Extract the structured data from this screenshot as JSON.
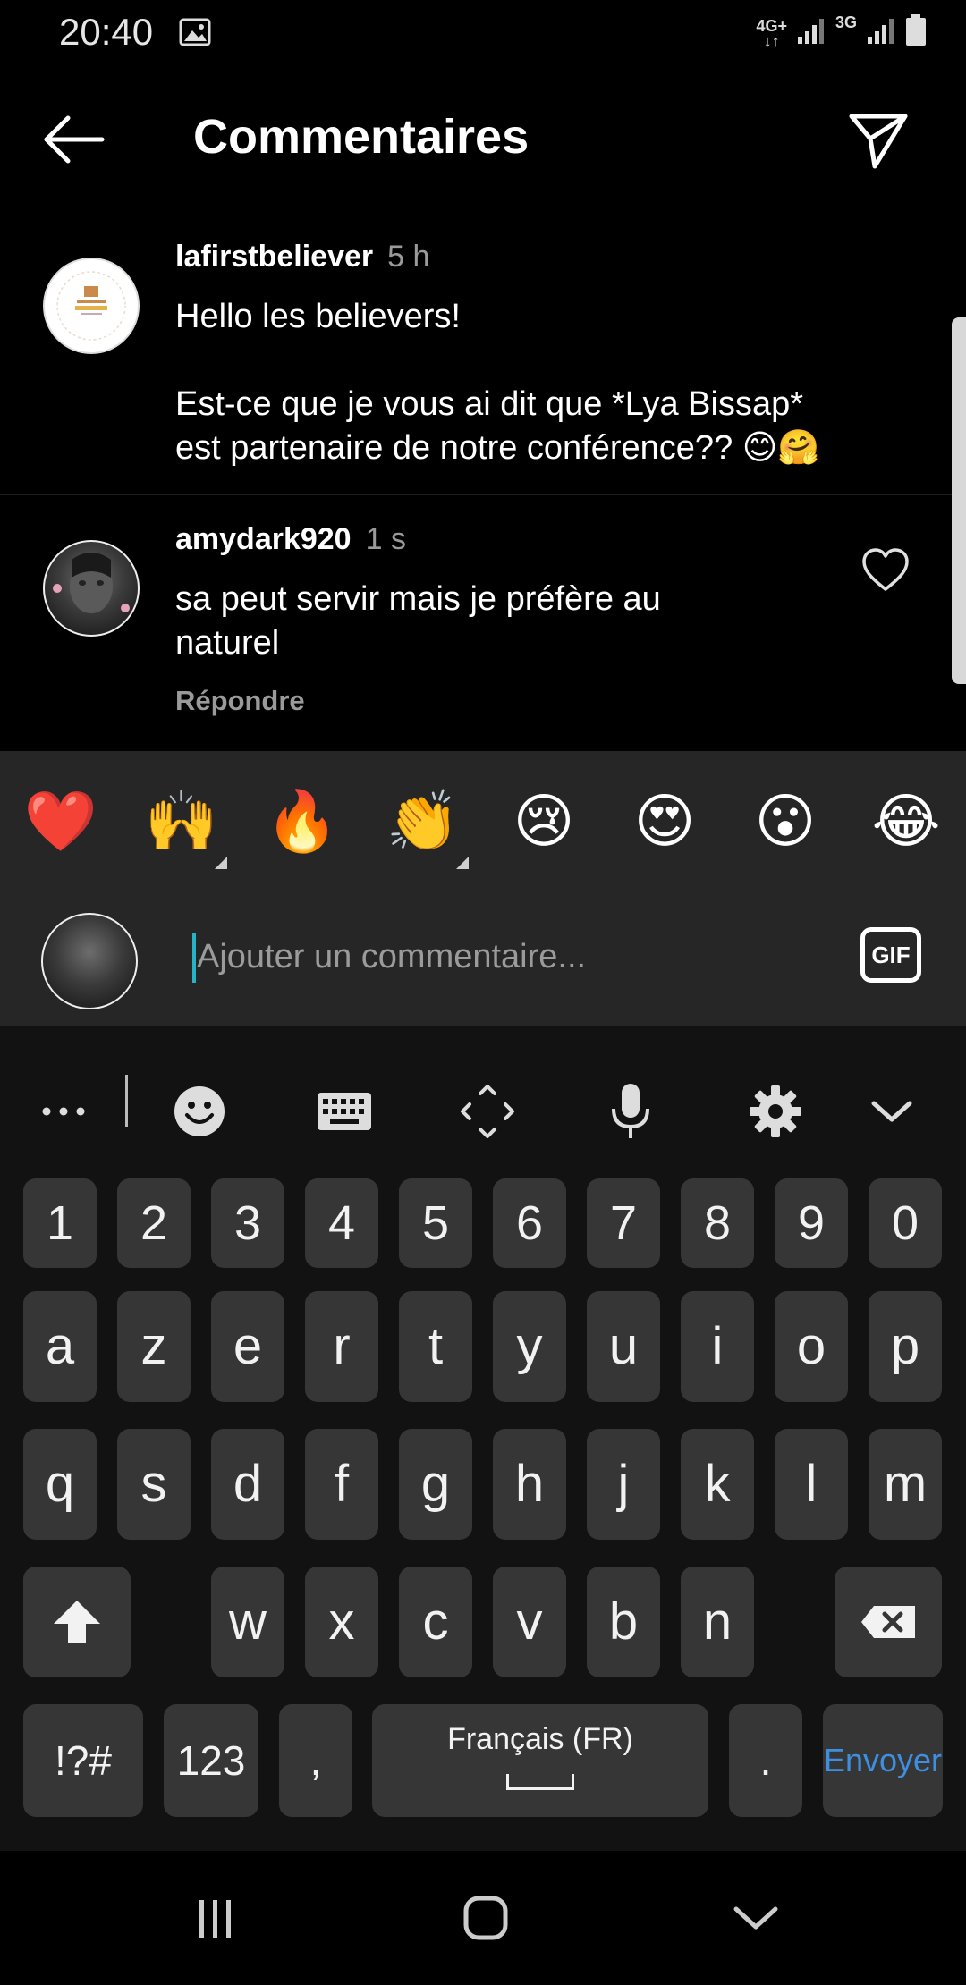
{
  "status_bar": {
    "time": "20:40",
    "net1": "4G+",
    "net2": "3G"
  },
  "header": {
    "title": "Commentaires",
    "back_icon": "arrow-left-icon",
    "send_icon": "paper-plane-icon"
  },
  "comments": [
    {
      "username": "lafirstbeliever",
      "time": "5 h",
      "line1": "Hello les believers!",
      "line2": "Est-ce que je vous ai dit que *Lya Bissap*",
      "line3": "est partenaire de notre conférence?? 😊🤗"
    },
    {
      "username": "amydark920",
      "time": "1 s",
      "line1": "sa peut servir mais je préfère au",
      "line2": "naturel",
      "reply": "Répondre"
    }
  ],
  "emoji_bar": [
    "❤️",
    "🙌",
    "🔥",
    "👏",
    "😢",
    "😍",
    "😮",
    "😂"
  ],
  "input": {
    "placeholder": "Ajouter un commentaire...",
    "gif_label": "GIF"
  },
  "keyboard": {
    "numbers": [
      "1",
      "2",
      "3",
      "4",
      "5",
      "6",
      "7",
      "8",
      "9",
      "0"
    ],
    "row1": [
      "a",
      "z",
      "e",
      "r",
      "t",
      "y",
      "u",
      "i",
      "o",
      "p"
    ],
    "row2": [
      "q",
      "s",
      "d",
      "f",
      "g",
      "h",
      "j",
      "k",
      "l",
      "m"
    ],
    "row3": [
      "w",
      "x",
      "c",
      "v",
      "b",
      "n"
    ],
    "symbols_key": "!?#",
    "numpad_key": "123",
    "comma_key": ",",
    "space_label": "Français (FR)",
    "period_key": ".",
    "enter_label": "Envoyer",
    "enter_color": "#3e8fe0"
  },
  "colors": {
    "background": "#000000",
    "panel": "#262626",
    "key": "#363636",
    "cursor": "#26b3c8"
  }
}
